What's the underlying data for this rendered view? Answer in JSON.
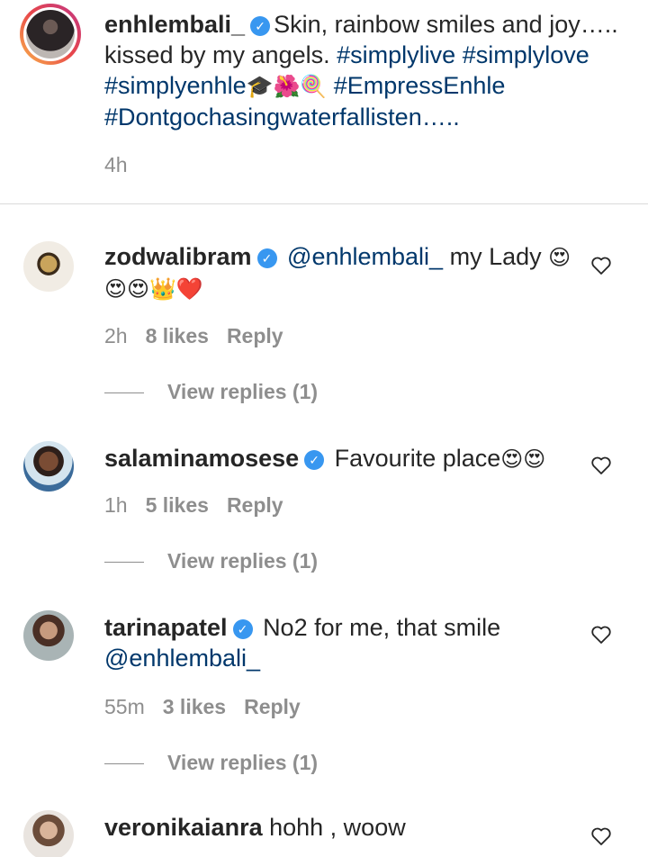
{
  "caption": {
    "username": "enhlembali_",
    "text_before": "Skin, rainbow smiles and joy….. kissed by my angels.",
    "hashtags_line1": [
      "#simplylive",
      "#simplylove"
    ],
    "hashtag_line2": "#simplyenhle",
    "emoji_line2": "🎓🌺🍭",
    "hashtag_line2b": "#EmpressEnhle",
    "hashtag_line3": "#Dontgochasingwaterfallisten",
    "line3_suffix": "…..",
    "time": "4h"
  },
  "comments": [
    {
      "username": "zodwalibram",
      "mention": "@enhlembali_",
      "text": "my Lady",
      "emoji_inline": "😍",
      "emoji_line2": "😍😍👑❤️",
      "time": "2h",
      "likes": "8 likes",
      "reply": "Reply",
      "view_replies": "View replies (1)"
    },
    {
      "username": "salaminamosese",
      "text": "Favourite place",
      "emoji_inline": "😍😍",
      "time": "1h",
      "likes": "5 likes",
      "reply": "Reply",
      "view_replies": "View replies (1)"
    },
    {
      "username": "tarinapatel",
      "text": "No2 for me, that smile",
      "mention": "@enhlembali_",
      "time": "55m",
      "likes": "3 likes",
      "reply": "Reply",
      "view_replies": "View replies (1)"
    },
    {
      "username": "veronikaianra",
      "text": "hohh , woow"
    }
  ],
  "colors": {
    "link": "#00376b",
    "verified": "#3897f0",
    "muted": "#8e8e8e"
  }
}
